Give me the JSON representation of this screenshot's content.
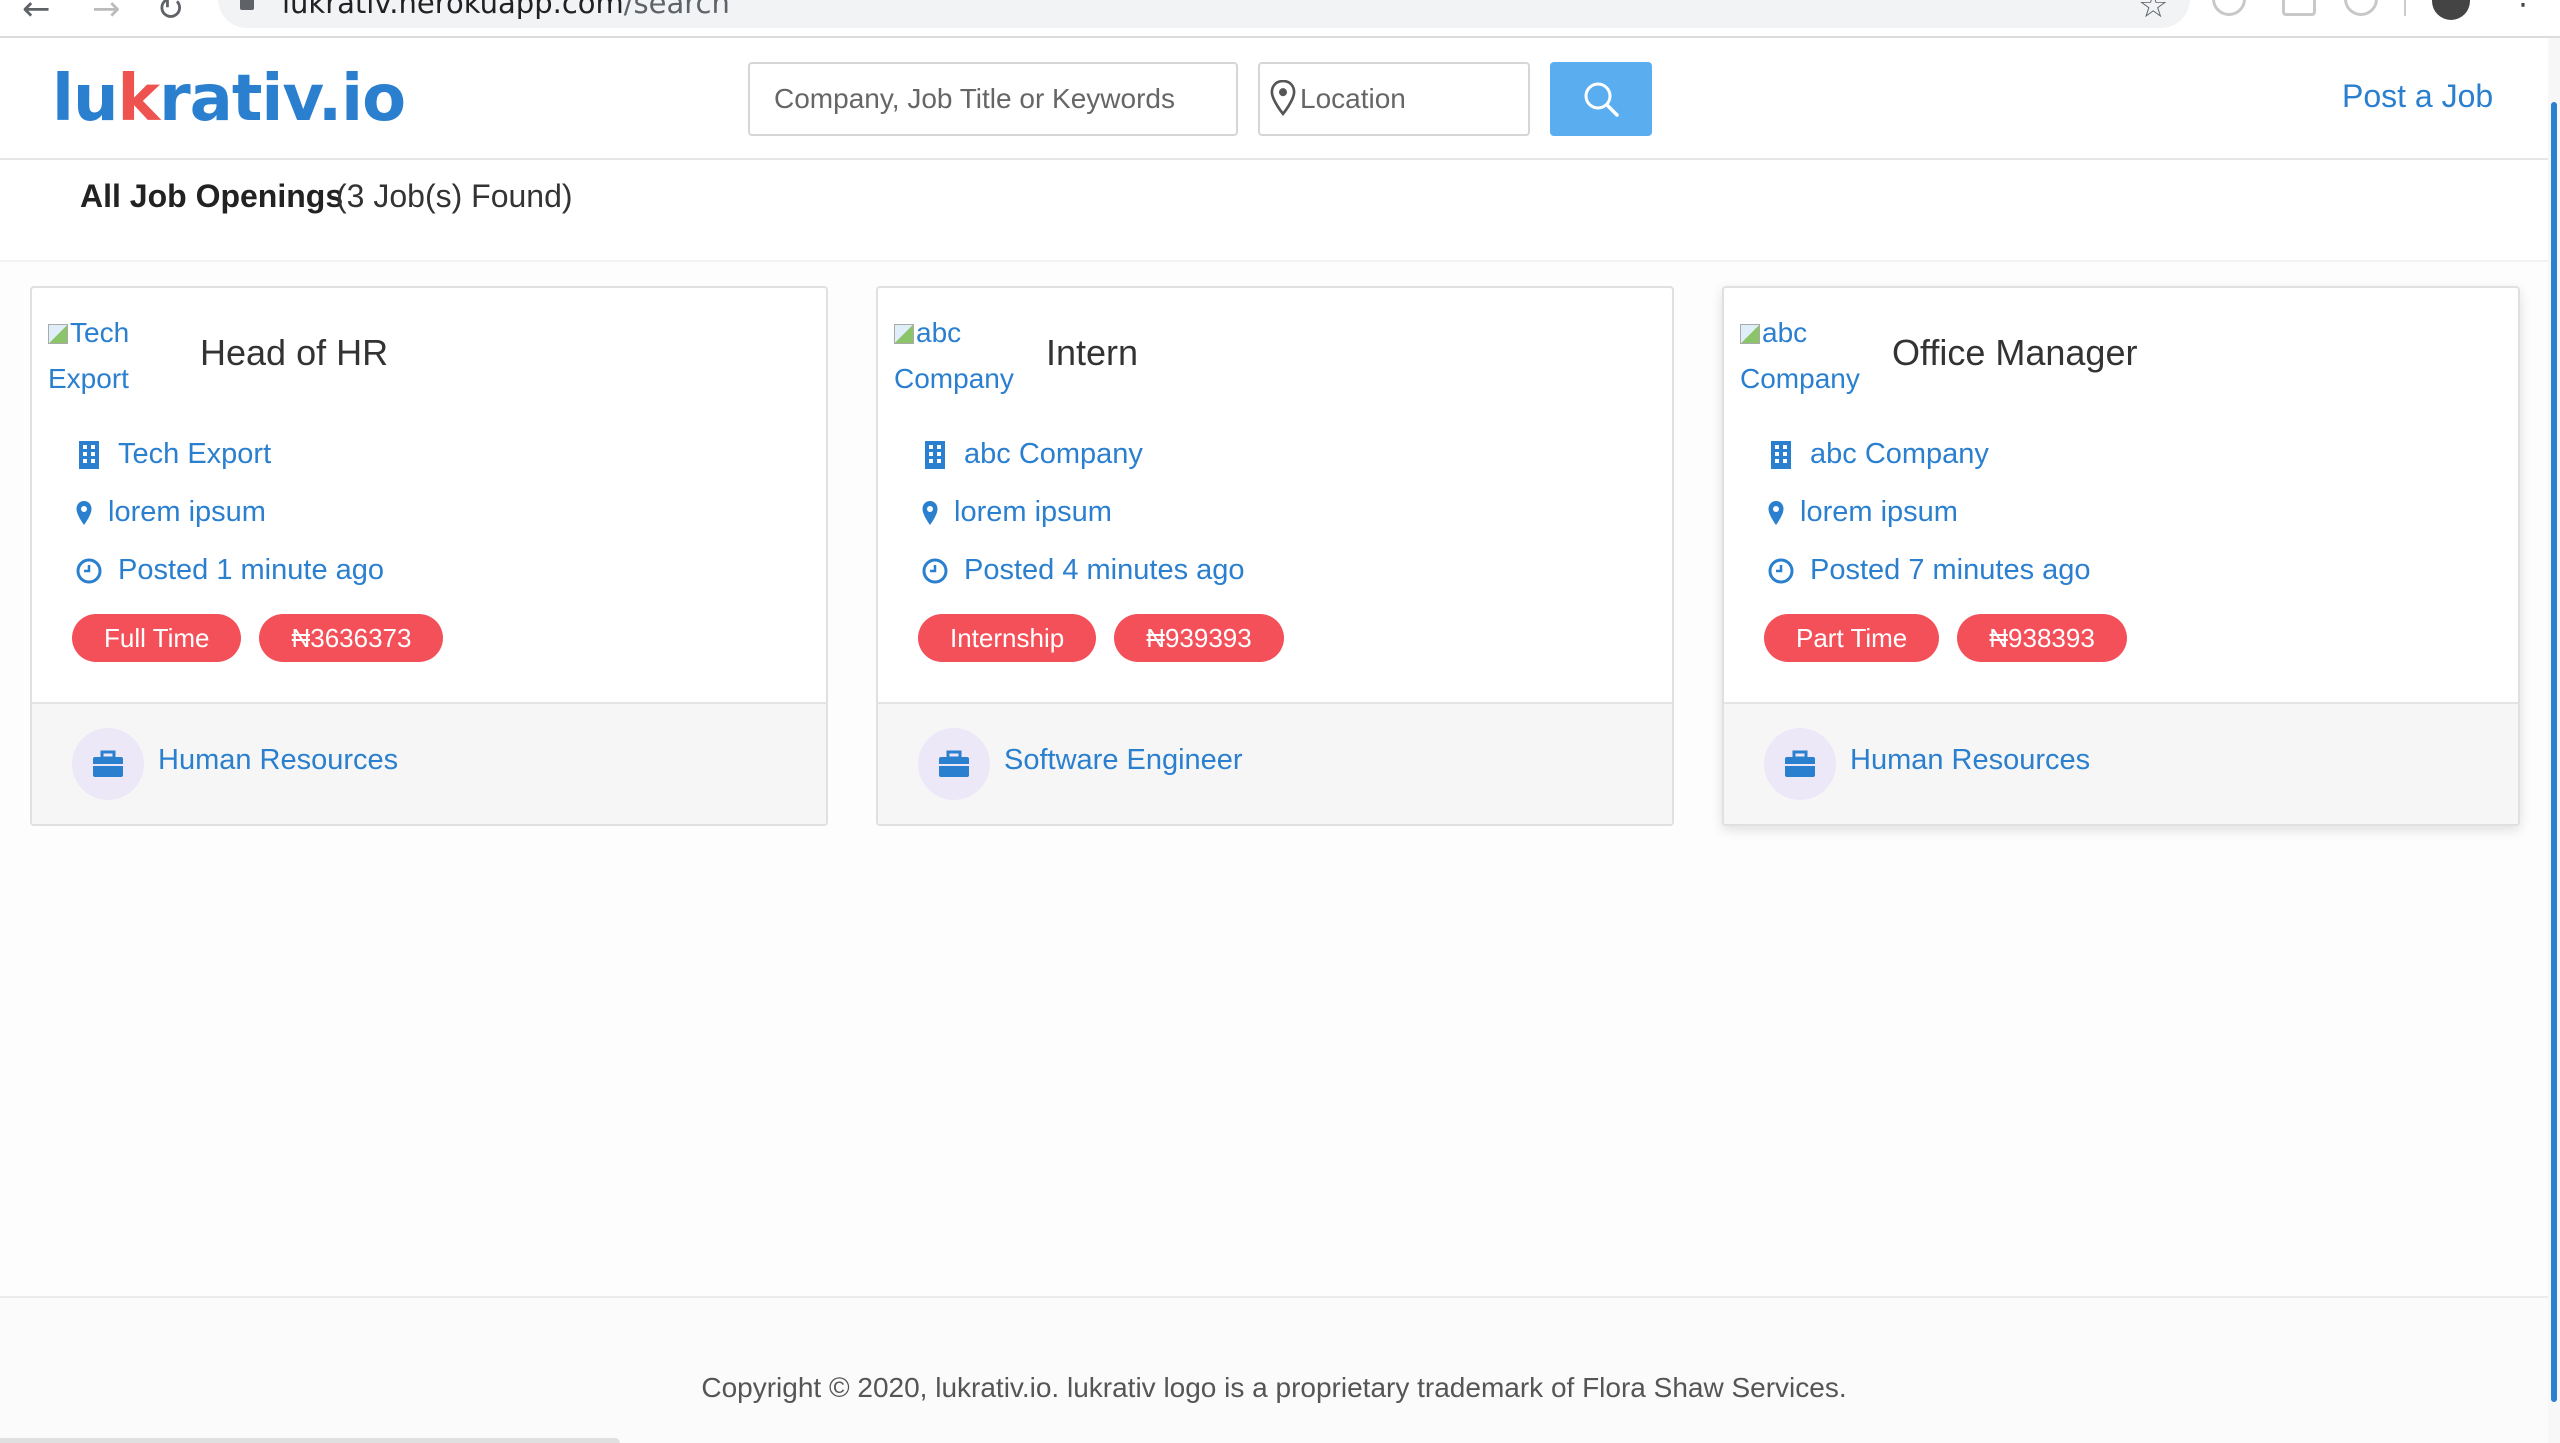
{
  "browser": {
    "url_host": "lukrativ.herokuapp.com",
    "url_path": "/search"
  },
  "header": {
    "logo_parts": [
      "lu",
      "k",
      "rativ.io"
    ],
    "search_placeholder": "Company, Job Title or Keywords",
    "location_placeholder": "Location",
    "post_job_label": "Post a Job"
  },
  "results": {
    "title": "All Job Openings",
    "count_text": "(3 Job(s) Found)"
  },
  "colors": {
    "brand_blue": "#2a7fcf",
    "badge_red": "#f4505a",
    "search_button": "#5aaef0"
  },
  "jobs": [
    {
      "logo_alt": "Tech Export",
      "title": "Head of HR",
      "company": "Tech Export",
      "location": "lorem ipsum",
      "posted": "Posted 1 minute ago",
      "job_type": "Full Time",
      "salary": "₦3636373",
      "category": "Human Resources"
    },
    {
      "logo_alt": "abc Company",
      "title": "Intern",
      "company": "abc Company",
      "location": "lorem ipsum",
      "posted": "Posted 4 minutes ago",
      "job_type": "Internship",
      "salary": "₦939393",
      "category": "Software Engineer"
    },
    {
      "logo_alt": "abc Company",
      "title": "Office Manager",
      "company": "abc Company",
      "location": "lorem ipsum",
      "posted": "Posted 7 minutes ago",
      "job_type": "Part Time",
      "salary": "₦938393",
      "category": "Human Resources"
    }
  ],
  "footer": {
    "copyright": "Copyright © 2020, lukrativ.io. lukrativ logo is a proprietary trademark of Flora Shaw Services."
  },
  "icons": {
    "company": "building-icon",
    "location": "map-pin-icon",
    "posted": "clock-icon",
    "category": "briefcase-icon"
  }
}
